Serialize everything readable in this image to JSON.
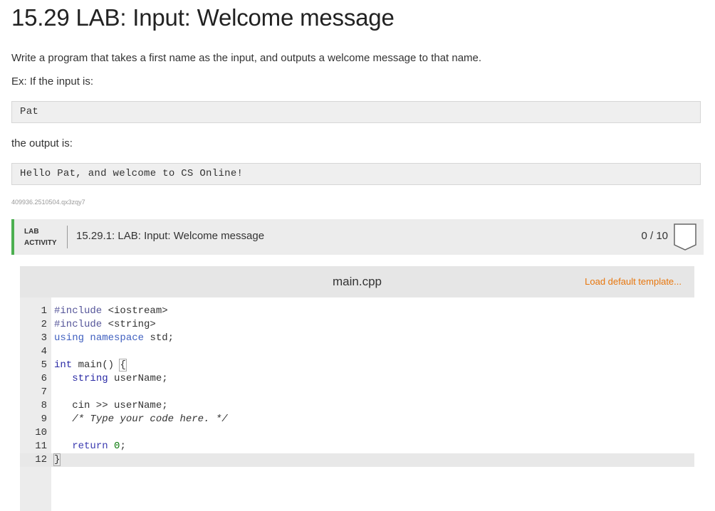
{
  "page": {
    "title": "15.29 LAB: Input: Welcome message",
    "description": "Write a program that takes a first name as the input, and outputs a welcome message to that name.",
    "example_intro": "Ex: If the input is:",
    "example_input": "Pat",
    "output_intro": "the output is:",
    "example_output": "Hello Pat, and welcome to CS Online!",
    "id_string": "409936.2510504.qx3zqy7"
  },
  "lab": {
    "tag_line1": "LAB",
    "tag_line2": "ACTIVITY",
    "name": "15.29.1: LAB: Input: Welcome message",
    "score": "0 / 10",
    "accent_color": "#4caf50"
  },
  "editor": {
    "filename": "main.cpp",
    "load_default_label": "Load default template...",
    "load_default_color": "#e8760c",
    "lines": [
      {
        "n": "1",
        "text": "#include <iostream>"
      },
      {
        "n": "2",
        "text": "#include <string>"
      },
      {
        "n": "3",
        "text": "using namespace std;"
      },
      {
        "n": "4",
        "text": ""
      },
      {
        "n": "5",
        "text": "int main() {"
      },
      {
        "n": "6",
        "text": "   string userName;"
      },
      {
        "n": "7",
        "text": ""
      },
      {
        "n": "8",
        "text": "   cin >> userName;"
      },
      {
        "n": "9",
        "text": "   /* Type your code here. */"
      },
      {
        "n": "10",
        "text": ""
      },
      {
        "n": "11",
        "text": "   return 0;"
      },
      {
        "n": "12",
        "text": "}"
      }
    ],
    "active_line": "12"
  }
}
